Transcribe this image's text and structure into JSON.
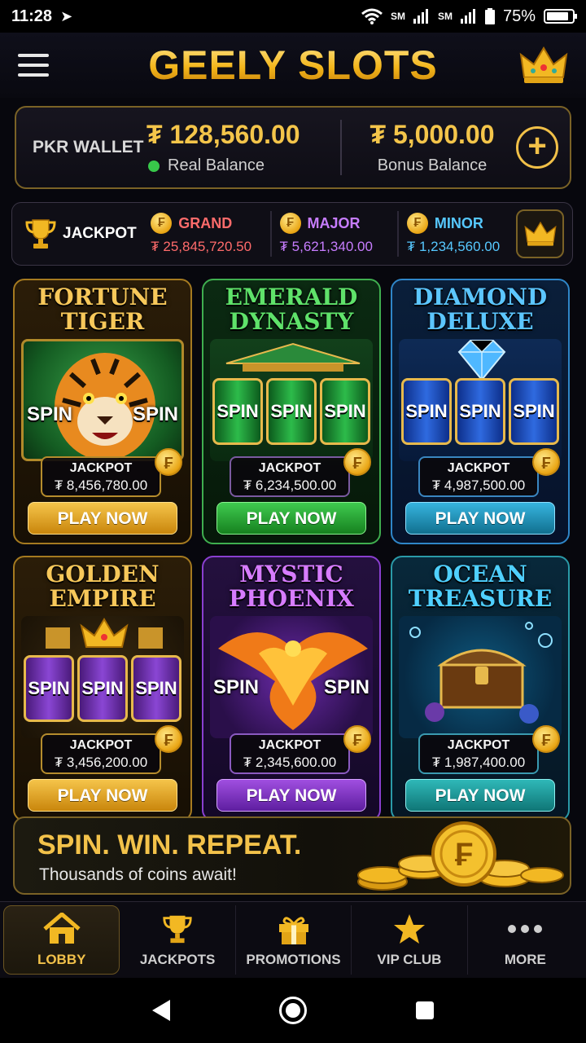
{
  "status_bar": {
    "time": "11:28",
    "battery": "75%",
    "sim1": "SM",
    "sim2": "SM"
  },
  "header": {
    "title": "GEELY SLOTS"
  },
  "wallet": {
    "label": "PKR WALLET",
    "real_amount": "₮ 128,560.00",
    "real_label": "Real Balance",
    "bonus_amount": "₮ 5,000.00",
    "bonus_label": "Bonus Balance",
    "add_label": "+"
  },
  "jackpots": {
    "label": "JACKPOT",
    "grand": {
      "name": "GRAND",
      "value": "₮ 25,845,720.50",
      "color": "#ff6b6b"
    },
    "major": {
      "name": "MAJOR",
      "value": "₮ 5,621,340.00",
      "color": "#c77dff"
    },
    "minor": {
      "name": "MINOR",
      "value": "₮ 1,234,560.00",
      "color": "#56c8ff"
    }
  },
  "games": [
    {
      "title1": "FORTUNE",
      "title2": "TIGER",
      "jackpot_label": "JACKPOT",
      "jackpot_value": "₮ 8,456,780.00",
      "play": "PLAY NOW",
      "spin": "SPIN",
      "theme": "gold"
    },
    {
      "title1": "EMERALD",
      "title2": "DYNASTY",
      "jackpot_label": "JACKPOT",
      "jackpot_value": "₮ 6,234,500.00",
      "play": "PLAY NOW",
      "spin": "SPIN",
      "theme": "green"
    },
    {
      "title1": "DIAMOND",
      "title2": "DELUXE",
      "jackpot_label": "JACKPOT",
      "jackpot_value": "₮ 4,987,500.00",
      "play": "PLAY NOW",
      "spin": "SPIN",
      "theme": "blue"
    },
    {
      "title1": "GOLDEN",
      "title2": "EMPIRE",
      "jackpot_label": "JACKPOT",
      "jackpot_value": "₮ 3,456,200.00",
      "play": "PLAY NOW",
      "spin": "SPIN",
      "theme": "gold"
    },
    {
      "title1": "MYSTIC",
      "title2": "PHOENIX",
      "jackpot_label": "JACKPOT",
      "jackpot_value": "₮ 2,345,600.00",
      "play": "PLAY NOW",
      "spin": "SPIN",
      "theme": "purple"
    },
    {
      "title1": "OCEAN",
      "title2": "TREASURE",
      "jackpot_label": "JACKPOT",
      "jackpot_value": "₮ 1,987,400.00",
      "play": "PLAY NOW",
      "spin": "SPIN",
      "theme": "teal"
    }
  ],
  "banner": {
    "title": "SPIN. WIN. REPEAT.",
    "subtitle": "Thousands of coins await!"
  },
  "bottom_nav": [
    {
      "label": "LOBBY",
      "icon": "home-icon",
      "active": true
    },
    {
      "label": "JACKPOTS",
      "icon": "trophy-icon"
    },
    {
      "label": "PROMOTIONS",
      "icon": "gift-icon"
    },
    {
      "label": "VIP CLUB",
      "icon": "star-icon"
    },
    {
      "label": "MORE",
      "icon": "more-dots-icon"
    }
  ],
  "coin_symbol": "₣"
}
